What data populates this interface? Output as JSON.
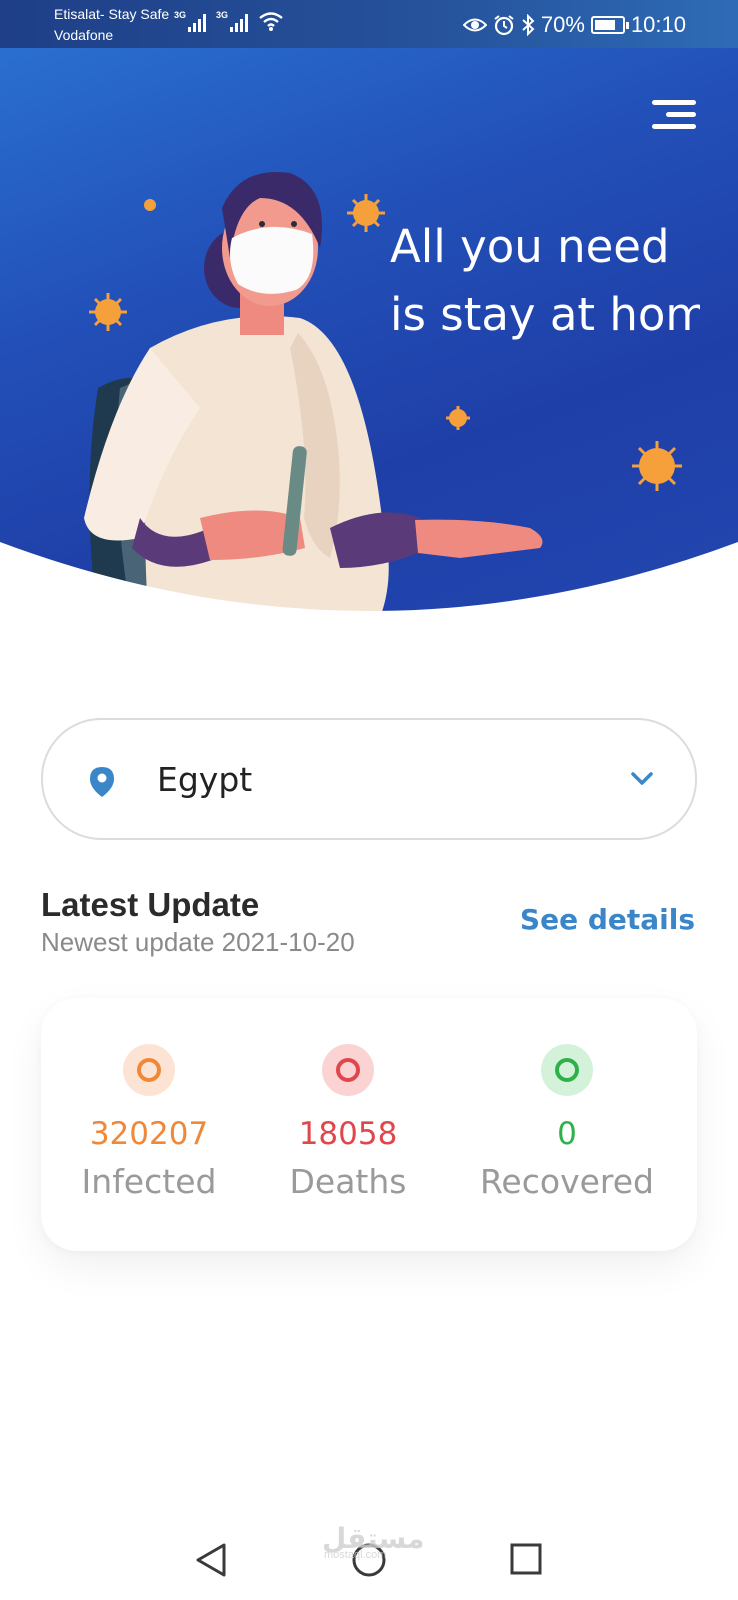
{
  "status_bar": {
    "carrier_primary": "Etisalat- Stay Safe",
    "carrier_secondary": "Vodafone",
    "network_1": "3G",
    "network_2": "3G",
    "battery": "70%",
    "time": "10:10",
    "icons": [
      "eye-icon",
      "alarm-icon",
      "bluetooth-icon",
      "battery-charging-icon",
      "wifi-icon",
      "signal-icon"
    ]
  },
  "hero": {
    "headline_line1": "All you need",
    "headline_line2": "is stay at home",
    "illustration": "woman-with-mask-illustration",
    "menu_icon": "hamburger-menu-icon",
    "colors": {
      "gradient_start": "#2a6fd0",
      "gradient_end": "#1f3fa8",
      "virus": "#f5a03a"
    }
  },
  "country_selector": {
    "value": "Egypt",
    "icon": "location-pin-icon",
    "dropdown_icon": "chevron-down-icon",
    "accent": "#3a86c8"
  },
  "latest_update": {
    "title": "Latest Update",
    "subtitle": "Newest update 2021-10-20",
    "see_details": "See details"
  },
  "stats": [
    {
      "value": "320207",
      "label": "Infected",
      "color": "#f0883a",
      "bg": "#fde3d3"
    },
    {
      "value": "18058",
      "label": "Deaths",
      "color": "#e0474c",
      "bg": "#fbd3d3"
    },
    {
      "value": "0",
      "label": "Recovered",
      "color": "#2fb14a",
      "bg": "#d4f2da"
    }
  ],
  "nav_bar": {
    "buttons": [
      "back-icon",
      "home-icon",
      "recents-icon"
    ],
    "watermark": "مستقل",
    "watermark_sub": "mostaql.com"
  }
}
